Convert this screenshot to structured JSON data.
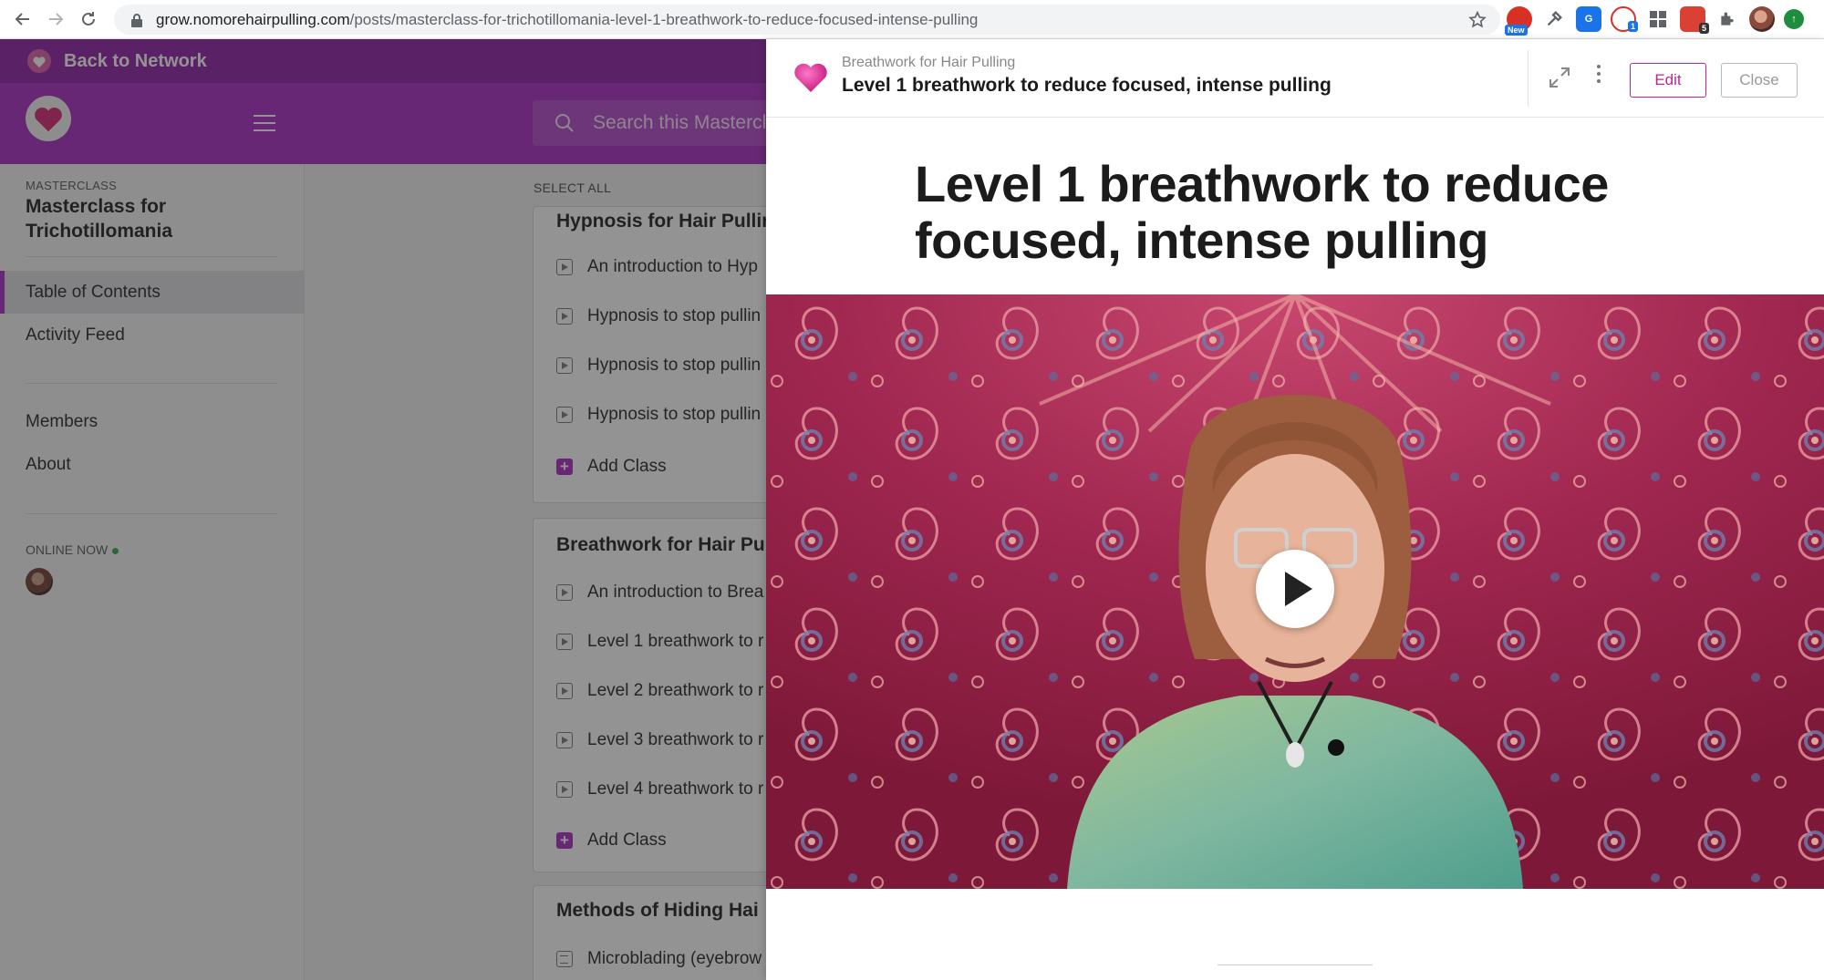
{
  "browser": {
    "url_host": "grow.nomorehairpulling.com",
    "url_path": "/posts/masterclass-for-trichotillomania-level-1-breathwork-to-reduce-focused-intense-pulling",
    "extensions": [
      {
        "name": "extension-new",
        "badge": "New",
        "color": "#d93025"
      },
      {
        "name": "eyedropper-extension",
        "badge": "",
        "color": "#5f6368"
      },
      {
        "name": "translate-extension",
        "badge": "",
        "color": "#1a73e8"
      },
      {
        "name": "lastpass-extension",
        "badge": "1",
        "color": "#d93025"
      },
      {
        "name": "grid-extension",
        "badge": "",
        "color": "#5f6368"
      },
      {
        "name": "todoist-extension",
        "badge": "5",
        "color": "#db4035"
      },
      {
        "name": "puzzle-extension",
        "badge": "",
        "color": "#5f6368"
      }
    ]
  },
  "network": {
    "back_label": "Back to Network"
  },
  "sidebar": {
    "kicker": "MASTERCLASS",
    "title": "Masterclass for Trichotillomania",
    "items": [
      {
        "label": "Table of Contents",
        "active": true
      },
      {
        "label": "Activity Feed",
        "active": false
      },
      {
        "label": "Members",
        "active": false
      },
      {
        "label": "About",
        "active": false
      }
    ],
    "online_label": "ONLINE NOW"
  },
  "main": {
    "search_placeholder": "Search this Mastercl",
    "select_all": "SELECT ALL",
    "sections": [
      {
        "title": "Hypnosis for Hair Pullin",
        "lessons": [
          "An introduction to Hyp",
          "Hypnosis to stop pullin",
          "Hypnosis to stop pullin",
          "Hypnosis to stop pullin"
        ],
        "add_label": "Add Class"
      },
      {
        "title": "Breathwork for Hair Pu",
        "lessons": [
          "An introduction to Brea",
          "Level 1 breathwork to r",
          "Level 2 breathwork to r",
          "Level 3 breathwork to r",
          "Level 4 breathwork to r"
        ],
        "add_label": "Add Class"
      },
      {
        "title": "Methods of Hiding Hai",
        "lessons": [
          "Microblading (eyebrow"
        ]
      }
    ]
  },
  "panel": {
    "subtitle": "Breathwork for Hair Pulling",
    "title": "Level 1 breathwork to reduce focused, intense pulling",
    "edit_label": "Edit",
    "close_label": "Close",
    "post_title": "Level 1 breathwork to reduce focused, intense pulling"
  },
  "colors": {
    "brand_purple": "#a726c0",
    "edit_pink": "#c0268f"
  }
}
